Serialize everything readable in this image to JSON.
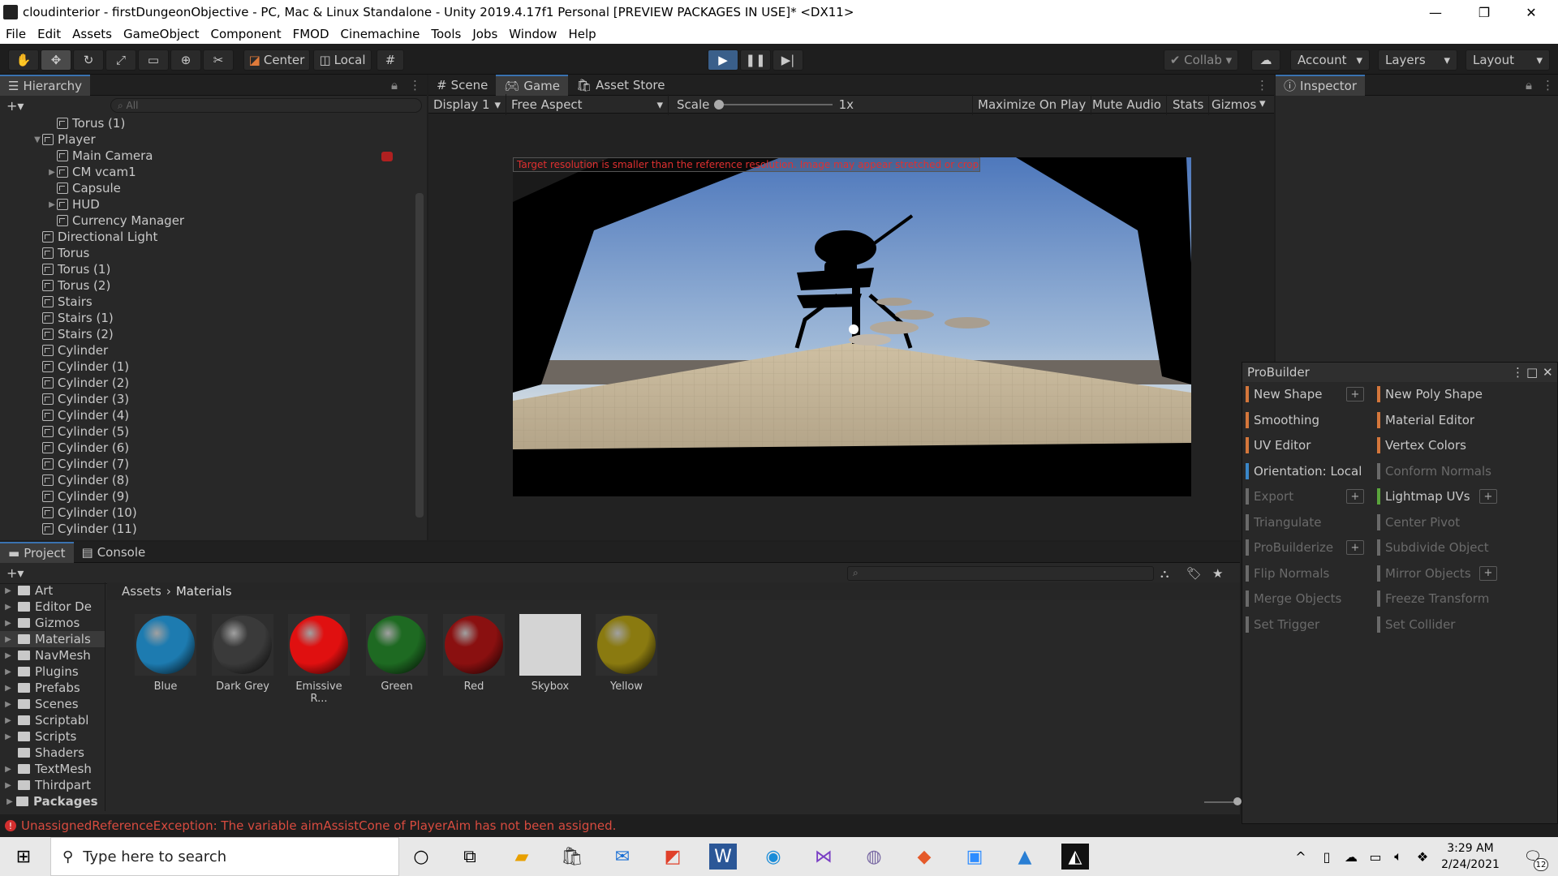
{
  "window": {
    "title": "cloudinterior - firstDungeonObjective - PC, Mac & Linux Standalone - Unity 2019.4.17f1 Personal [PREVIEW PACKAGES IN USE]* <DX11>",
    "minimize": "—",
    "maximize": "❐",
    "close": "✕"
  },
  "menu": [
    "File",
    "Edit",
    "Assets",
    "GameObject",
    "Component",
    "FMOD",
    "Cinemachine",
    "Tools",
    "Jobs",
    "Window",
    "Help"
  ],
  "toolbar": {
    "center": "Center",
    "local": "Local",
    "collab": "Collab",
    "account": "Account",
    "layers": "Layers",
    "layout": "Layout"
  },
  "hierarchy": {
    "tab": "Hierarchy",
    "search_placeholder": "All",
    "rows": [
      {
        "label": "Torus (1)",
        "indent": 2,
        "arrow": ""
      },
      {
        "label": "Player",
        "indent": 1,
        "arrow": "▼"
      },
      {
        "label": "Main Camera",
        "indent": 2,
        "arrow": ""
      },
      {
        "label": "CM vcam1",
        "indent": 2,
        "arrow": "▶"
      },
      {
        "label": "Capsule",
        "indent": 2,
        "arrow": ""
      },
      {
        "label": "HUD",
        "indent": 2,
        "arrow": "▶"
      },
      {
        "label": "Currency Manager",
        "indent": 2,
        "arrow": ""
      },
      {
        "label": "Directional Light",
        "indent": 1,
        "arrow": ""
      },
      {
        "label": "Torus",
        "indent": 1,
        "arrow": ""
      },
      {
        "label": "Torus (1)",
        "indent": 1,
        "arrow": ""
      },
      {
        "label": "Torus (2)",
        "indent": 1,
        "arrow": ""
      },
      {
        "label": "Stairs",
        "indent": 1,
        "arrow": ""
      },
      {
        "label": "Stairs (1)",
        "indent": 1,
        "arrow": ""
      },
      {
        "label": "Stairs (2)",
        "indent": 1,
        "arrow": ""
      },
      {
        "label": "Cylinder",
        "indent": 1,
        "arrow": ""
      },
      {
        "label": "Cylinder (1)",
        "indent": 1,
        "arrow": ""
      },
      {
        "label": "Cylinder (2)",
        "indent": 1,
        "arrow": ""
      },
      {
        "label": "Cylinder (3)",
        "indent": 1,
        "arrow": ""
      },
      {
        "label": "Cylinder (4)",
        "indent": 1,
        "arrow": ""
      },
      {
        "label": "Cylinder (5)",
        "indent": 1,
        "arrow": ""
      },
      {
        "label": "Cylinder (6)",
        "indent": 1,
        "arrow": ""
      },
      {
        "label": "Cylinder (7)",
        "indent": 1,
        "arrow": ""
      },
      {
        "label": "Cylinder (8)",
        "indent": 1,
        "arrow": ""
      },
      {
        "label": "Cylinder (9)",
        "indent": 1,
        "arrow": ""
      },
      {
        "label": "Cylinder (10)",
        "indent": 1,
        "arrow": ""
      },
      {
        "label": "Cylinder (11)",
        "indent": 1,
        "arrow": ""
      }
    ]
  },
  "game": {
    "tabs": [
      "Scene",
      "Game",
      "Asset Store"
    ],
    "display": "Display 1",
    "aspect": "Free Aspect",
    "scale_label": "Scale",
    "scale_value": "1x",
    "maximize": "Maximize On Play",
    "mute": "Mute Audio",
    "stats": "Stats",
    "gizmos": "Gizmos",
    "warning": "Target resolution is smaller than the reference resolution. Image may appear stretched or cropped."
  },
  "inspector": {
    "tab": "Inspector"
  },
  "probuilder": {
    "title": "ProBuilder",
    "left": [
      {
        "label": "New Shape",
        "color": "#d4763b",
        "enabled": true,
        "plus": true
      },
      {
        "label": "Smoothing",
        "color": "#d4763b",
        "enabled": true,
        "plus": false
      },
      {
        "label": "UV Editor",
        "color": "#d4763b",
        "enabled": true,
        "plus": false
      },
      {
        "label": "Orientation: Local",
        "color": "#3a86c8",
        "enabled": true,
        "plus": false
      },
      {
        "label": "Export",
        "color": "#6a6a6a",
        "enabled": false,
        "plus": true
      },
      {
        "label": "Triangulate",
        "color": "#6a6a6a",
        "enabled": false,
        "plus": false
      },
      {
        "label": "ProBuilderize",
        "color": "#6a6a6a",
        "enabled": false,
        "plus": true
      },
      {
        "label": "Flip Normals",
        "color": "#6a6a6a",
        "enabled": false,
        "plus": false
      },
      {
        "label": "Merge Objects",
        "color": "#6a6a6a",
        "enabled": false,
        "plus": false
      },
      {
        "label": "Set Trigger",
        "color": "#6a6a6a",
        "enabled": false,
        "plus": false
      }
    ],
    "right": [
      {
        "label": "New Poly Shape",
        "color": "#d4763b",
        "enabled": true,
        "plus": false
      },
      {
        "label": "Material Editor",
        "color": "#d4763b",
        "enabled": true,
        "plus": false
      },
      {
        "label": "Vertex Colors",
        "color": "#d4763b",
        "enabled": true,
        "plus": false
      },
      {
        "label": "Conform Normals",
        "color": "#6a6a6a",
        "enabled": false,
        "plus": false
      },
      {
        "label": "Lightmap UVs",
        "color": "#5aa43c",
        "enabled": true,
        "plus": true
      },
      {
        "label": "Center Pivot",
        "color": "#6a6a6a",
        "enabled": false,
        "plus": false
      },
      {
        "label": "Subdivide Object",
        "color": "#6a6a6a",
        "enabled": false,
        "plus": false
      },
      {
        "label": "Mirror Objects",
        "color": "#6a6a6a",
        "enabled": false,
        "plus": true
      },
      {
        "label": "Freeze Transform",
        "color": "#6a6a6a",
        "enabled": false,
        "plus": false
      },
      {
        "label": "Set Collider",
        "color": "#6a6a6a",
        "enabled": false,
        "plus": false
      }
    ]
  },
  "project": {
    "tabs": [
      "Project",
      "Console"
    ],
    "breadcrumb": [
      "Assets",
      "Materials"
    ],
    "folders": [
      "Art",
      "Editor De",
      "Gizmos",
      "Materials",
      "NavMesh",
      "Plugins",
      "Prefabs",
      "Scenes",
      "Scriptabl",
      "Scripts",
      "Shaders",
      "TextMesh",
      "Thirdpart"
    ],
    "packages": "Packages",
    "assets": [
      {
        "label": "Blue",
        "color": "#1d7bb0"
      },
      {
        "label": "Dark Grey",
        "color": "#3a3a3a"
      },
      {
        "label": "Emissive R...",
        "color": "#e01010"
      },
      {
        "label": "Green",
        "color": "#1e6a22"
      },
      {
        "label": "Red",
        "color": "#8a1010"
      },
      {
        "label": "Skybox",
        "color": "#d4d4d4"
      },
      {
        "label": "Yellow",
        "color": "#8a7a10"
      }
    ]
  },
  "status": {
    "error": "UnassignedReferenceException: The variable aimAssistCone of PlayerAim has not been assigned."
  },
  "taskbar": {
    "search_placeholder": "Type here to search",
    "time": "3:29 AM",
    "date": "2/24/2021",
    "notifications": "12"
  }
}
